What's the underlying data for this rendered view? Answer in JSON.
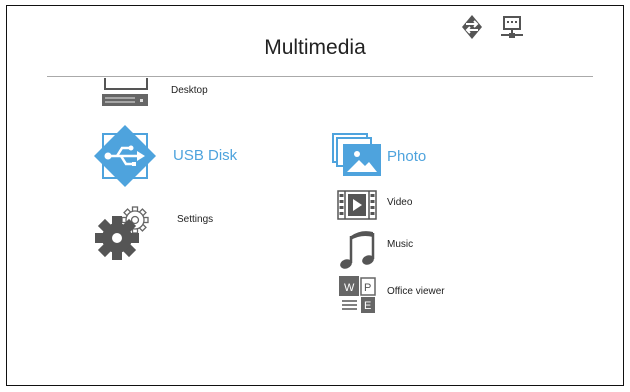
{
  "screen": {
    "title": "Multimedia"
  },
  "status_icons": [
    {
      "name": "network-diamond-icon"
    },
    {
      "name": "lan-computer-icon"
    }
  ],
  "menu": {
    "left": [
      {
        "label": "Desktop",
        "icon": "desktop-computer-icon",
        "selected": false
      },
      {
        "label": "USB Disk",
        "icon": "usb-disk-icon",
        "selected": true
      },
      {
        "label": "Settings",
        "icon": "gears-icon",
        "selected": false
      }
    ],
    "right": [
      {
        "label": "Photo",
        "icon": "photo-icon",
        "selected": true
      },
      {
        "label": "Video",
        "icon": "video-icon",
        "selected": false
      },
      {
        "label": "Music",
        "icon": "music-note-icon",
        "selected": false
      },
      {
        "label": "Office viewer",
        "icon": "office-document-icon",
        "selected": false
      }
    ]
  },
  "colors": {
    "accent": "#4ea3dd",
    "icon_gray": "#555555",
    "line": "#aaaaaa"
  }
}
